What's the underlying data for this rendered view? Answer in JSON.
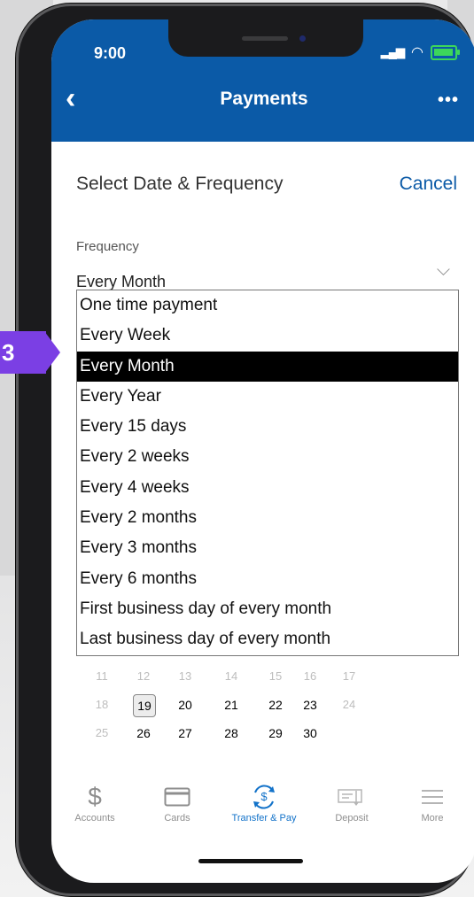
{
  "status": {
    "time": "9:00"
  },
  "nav": {
    "title": "Payments",
    "back": "‹",
    "more": "•••"
  },
  "form": {
    "heading": "Select Date & Frequency",
    "cancel": "Cancel",
    "frequency_label": "Frequency",
    "frequency_value": "Every Month",
    "options": [
      "One time payment",
      "Every Week",
      "Every Month",
      "Every Year",
      "Every 15 days",
      "Every 2 weeks",
      "Every 4 weeks",
      "Every 2 months",
      "Every 3 months",
      "Every 6 months",
      "First business day of every month",
      "Last business day of every month"
    ],
    "selected_option": "Every Month"
  },
  "calendar": {
    "rows": [
      [
        "11",
        "12",
        "13",
        "14",
        "15",
        "16",
        "17"
      ],
      [
        "18",
        "19",
        "20",
        "21",
        "22",
        "23",
        "24"
      ],
      [
        "25",
        "26",
        "27",
        "28",
        "29",
        "30"
      ]
    ],
    "selected_day": "19"
  },
  "tabs": [
    {
      "label": "Accounts",
      "icon": "dollar-icon"
    },
    {
      "label": "Cards",
      "icon": "card-icon"
    },
    {
      "label": "Transfer & Pay",
      "icon": "transfer-icon",
      "active": true
    },
    {
      "label": "Deposit",
      "icon": "check-icon"
    },
    {
      "label": "More",
      "icon": "menu-icon"
    }
  ],
  "annotation": {
    "step": "3"
  },
  "colors": {
    "brand": "#0b5aa7",
    "active_tab": "#1272c9",
    "marker": "#7b3fe4"
  }
}
